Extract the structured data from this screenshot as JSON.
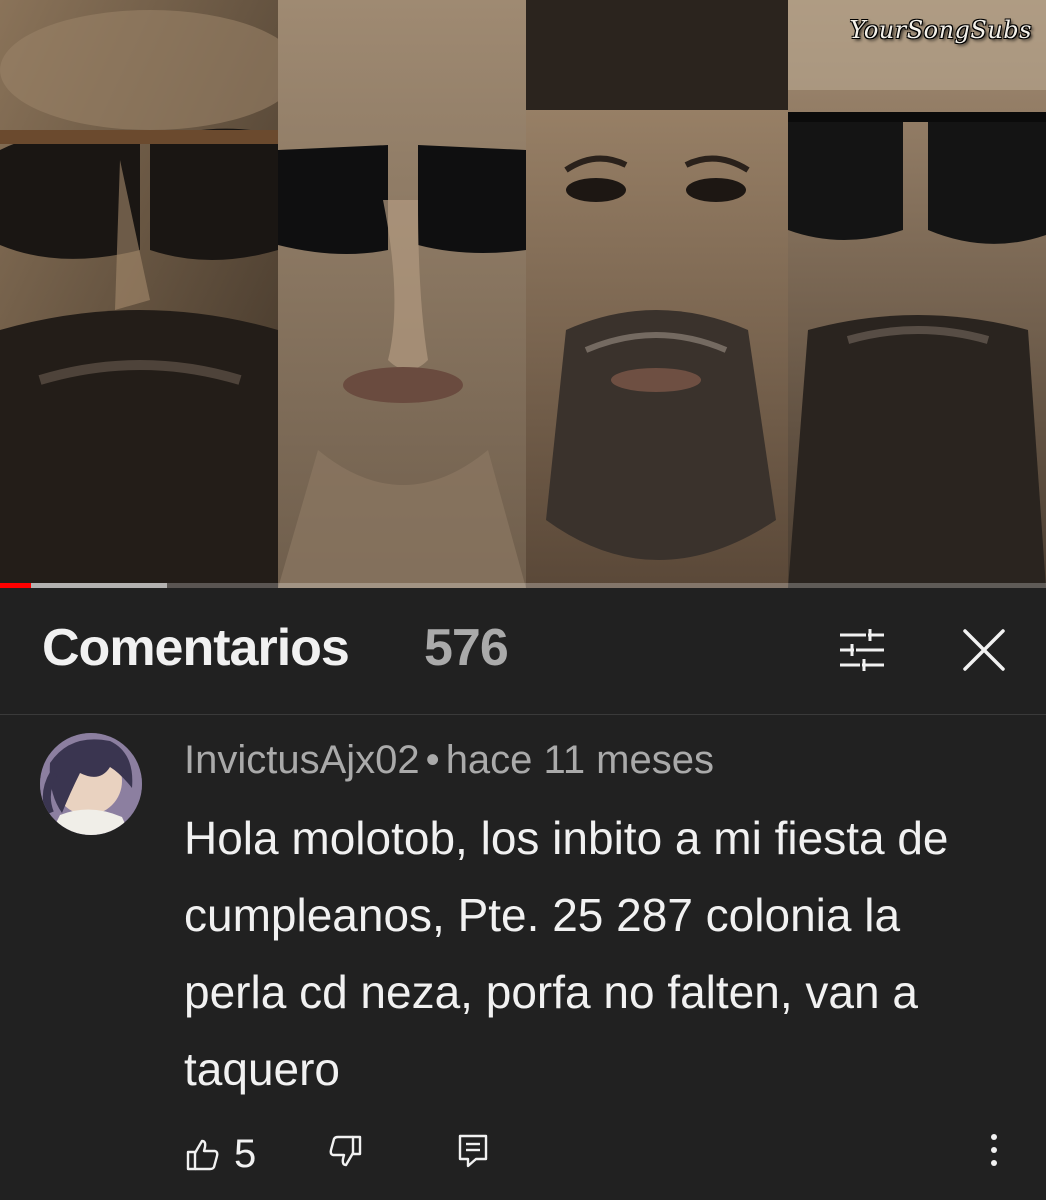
{
  "video": {
    "watermark": "YourSongSubs",
    "progress_played": 0.03,
    "progress_buffered": 0.16
  },
  "header": {
    "title": "Comentarios",
    "count": "576"
  },
  "icons": {
    "filter": "filter-sliders-icon",
    "close": "close-icon",
    "like": "thumb-up-icon",
    "dislike": "thumb-down-icon",
    "reply": "reply-comment-icon",
    "more": "more-vertical-icon"
  },
  "comment": {
    "author": "InvictusAjx02",
    "separator": "•",
    "time": "hace 11 meses",
    "text": "Hola molotob, los inbito a mi fiesta de cumpleanos, Pte. 25 287 colonia la perla cd neza, porfa no falten, van a taquero",
    "likes": "5"
  },
  "colors": {
    "background": "#212121",
    "primary_text": "#f1f1f1",
    "secondary_text": "#aaaaaa",
    "progress": "#ff0000"
  }
}
